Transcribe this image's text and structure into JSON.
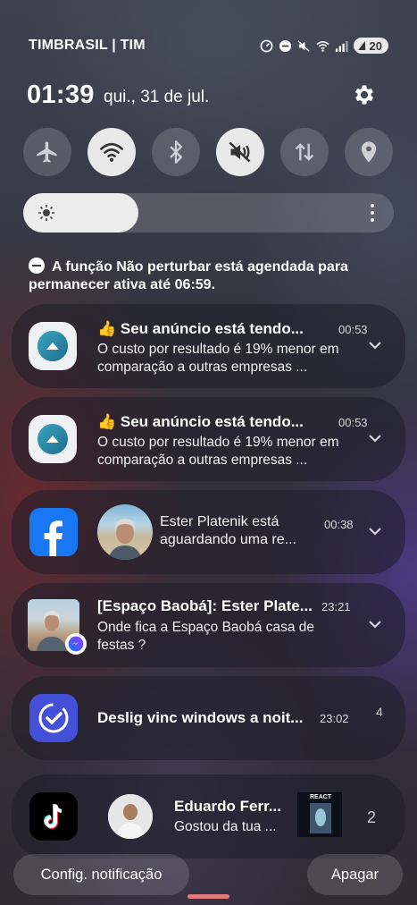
{
  "statusbar": {
    "carrier": "TIMBRASIL | TIM",
    "battery": "20",
    "icons": [
      "data-saver-icon",
      "dnd-status-icon",
      "mute-icon",
      "wifi-icon",
      "signal-icon"
    ]
  },
  "header": {
    "time": "01:39",
    "date": "qui., 31 de jul."
  },
  "quick_settings": [
    {
      "name": "airplane",
      "state": "off"
    },
    {
      "name": "wifi",
      "state": "on"
    },
    {
      "name": "bluetooth",
      "state": "off"
    },
    {
      "name": "mute",
      "state": "on"
    },
    {
      "name": "mobile-data",
      "state": "off"
    },
    {
      "name": "location",
      "state": "off"
    }
  ],
  "brightness": {
    "level": 0.31
  },
  "dnd_notice": "A função Não perturbar está agendada para permanecer ativa até 06:59.",
  "notifications": [
    {
      "app": "ads",
      "title": "👍 Seu anúncio está tendo...",
      "time": "00:53",
      "body": "O custo por resultado é 19% menor em comparação a outras empresas ..."
    },
    {
      "app": "ads",
      "title": "👍 Seu anúncio está tendo...",
      "time": "00:53",
      "body": "O custo por resultado é 19% menor em comparação a outras empresas ..."
    },
    {
      "app": "facebook",
      "title": "Ester Platenik está aguardando uma re...",
      "time": "00:38"
    },
    {
      "app": "messenger",
      "title": "[Espaço Baobá]: Ester Plate...",
      "time": "23:21",
      "body": "Onde fica a Espaço Baobá casa de festas ?"
    },
    {
      "app": "tasks",
      "title": "Deslig vinc windows a noit...",
      "time": "23:02",
      "count": "4"
    },
    {
      "app": "tiktok",
      "title": "Eduardo Ferr...",
      "body": "Gostou da tua ...",
      "count": "2",
      "thumb_label": "REACT"
    }
  ],
  "footer": {
    "settings_label": "Config. notificação",
    "clear_label": "Apagar"
  },
  "colors": {
    "facebook": "#1877f2",
    "tasks": "#4550d8",
    "handle": "#e27b7b"
  }
}
